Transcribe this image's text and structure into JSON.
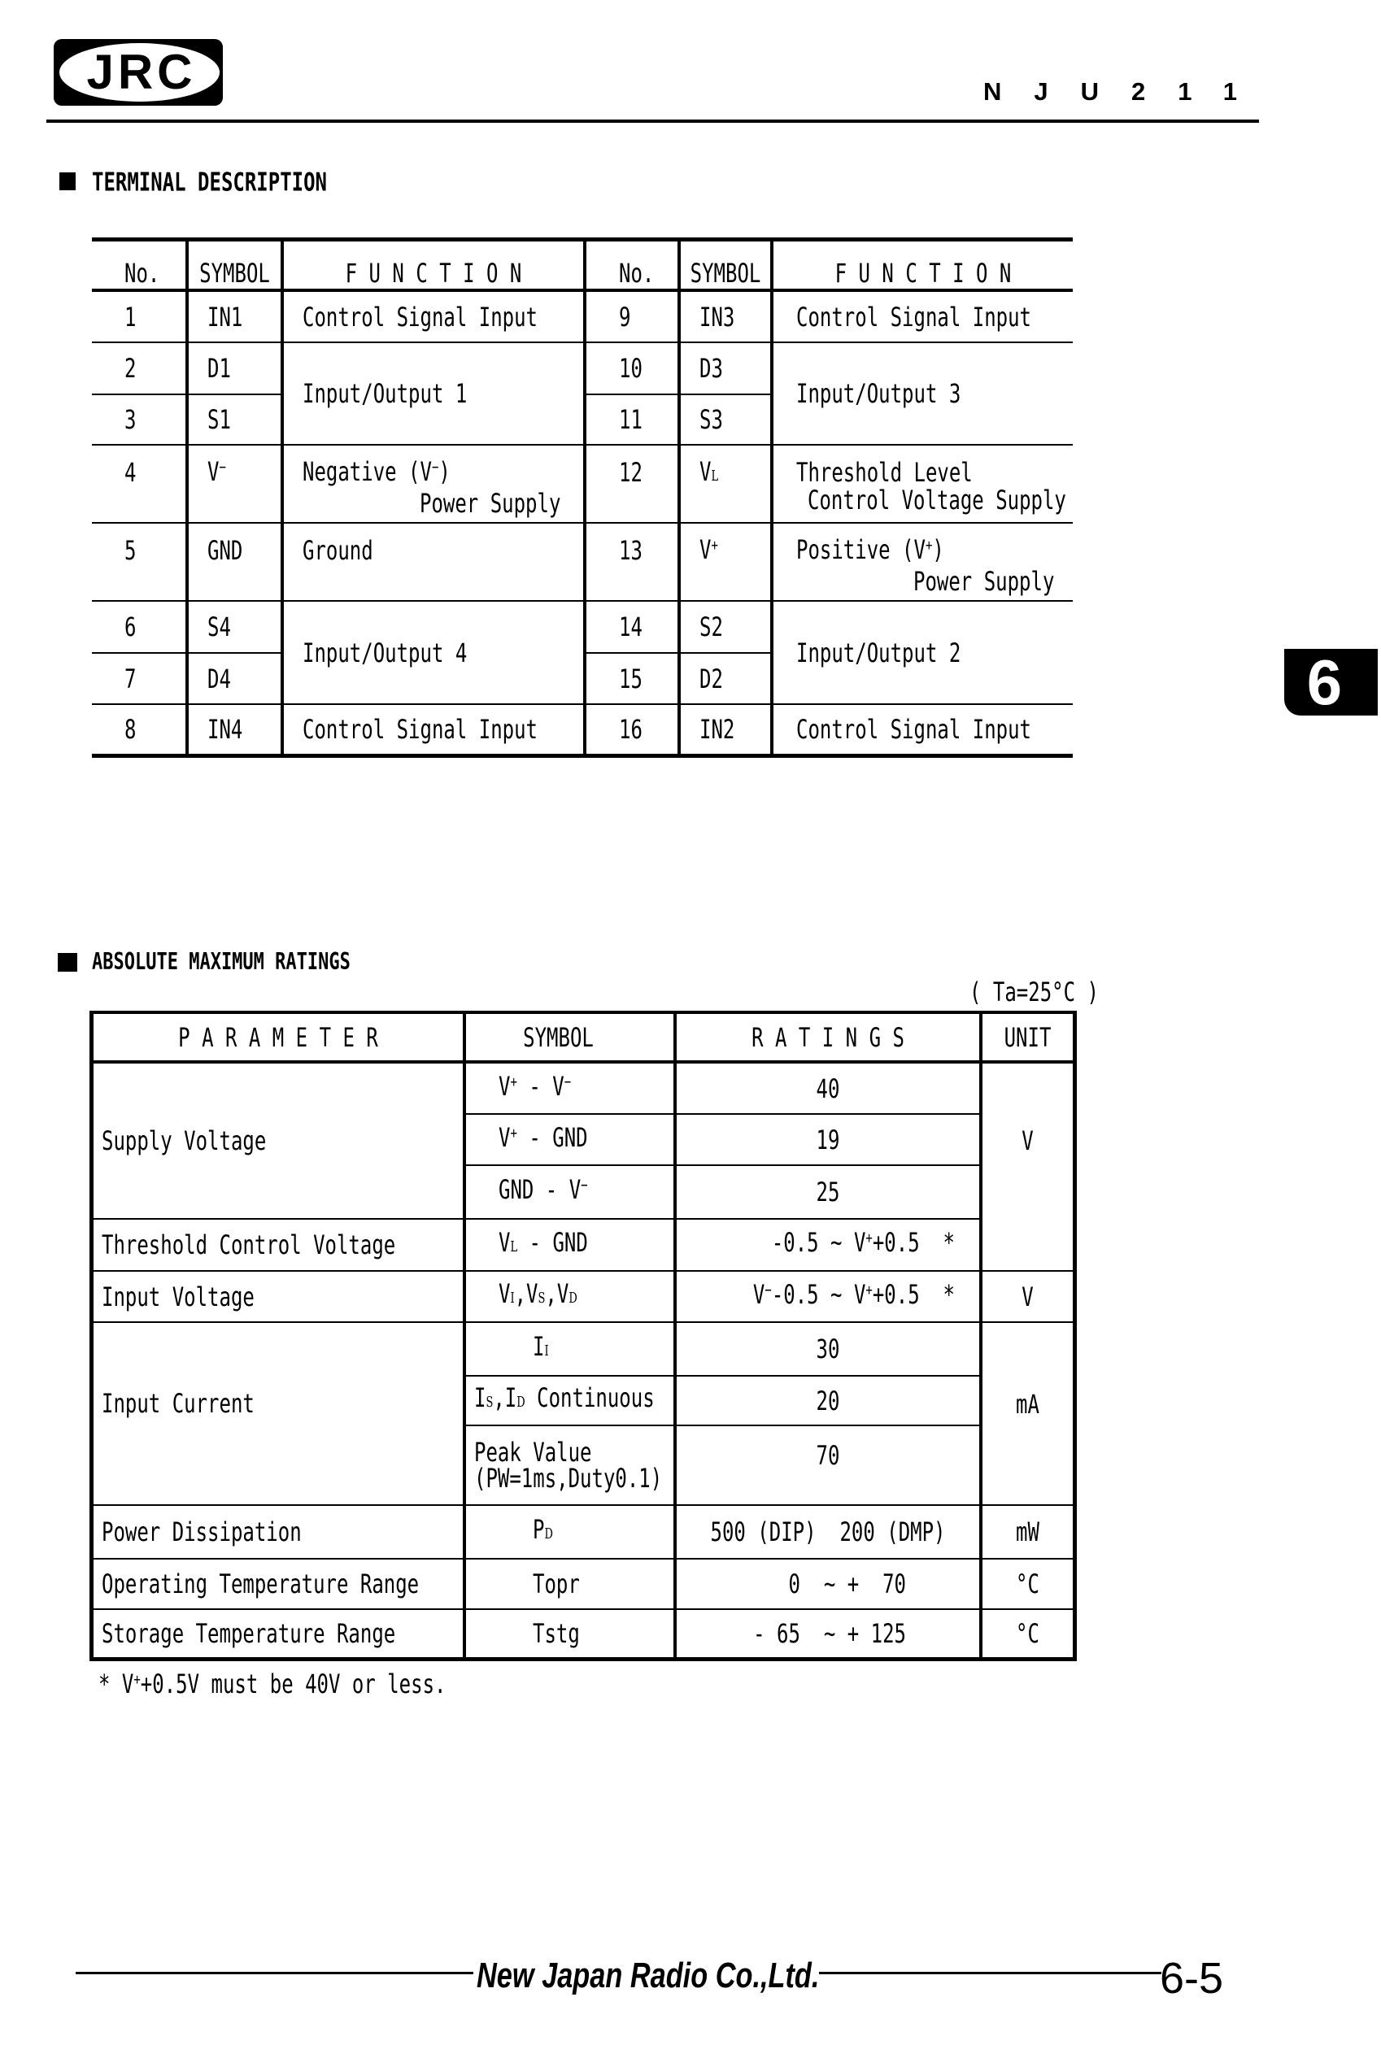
{
  "header": {
    "logo": "JRC",
    "part_number": "NJU211"
  },
  "side_tab": {
    "label": "6"
  },
  "terminal_description": {
    "title": "TERMINAL DESCRIPTION",
    "headers": {
      "no": "No.",
      "symbol": "SYMBOL",
      "function": "F U N C T I O N"
    },
    "pins": [
      {
        "no": "1",
        "symbol": "IN1"
      },
      {
        "no": "2",
        "symbol": "D1"
      },
      {
        "no": "3",
        "symbol": "S1"
      },
      {
        "no": "4",
        "symbol": [
          {
            "t": "V"
          },
          {
            "t": "−",
            "s": "sup"
          }
        ]
      },
      {
        "no": "5",
        "symbol": "GND"
      },
      {
        "no": "6",
        "symbol": "S4"
      },
      {
        "no": "7",
        "symbol": "D4"
      },
      {
        "no": "8",
        "symbol": "IN4"
      },
      {
        "no": "9",
        "symbol": "IN3"
      },
      {
        "no": "10",
        "symbol": "D3"
      },
      {
        "no": "11",
        "symbol": "S3"
      },
      {
        "no": "12",
        "symbol": [
          {
            "t": "V"
          },
          {
            "t": "L",
            "s": "sub"
          }
        ]
      },
      {
        "no": "13",
        "symbol": [
          {
            "t": "V"
          },
          {
            "t": "+",
            "s": "sup"
          }
        ]
      },
      {
        "no": "14",
        "symbol": "S2"
      },
      {
        "no": "15",
        "symbol": "D2"
      },
      {
        "no": "16",
        "symbol": "IN2"
      }
    ],
    "functions": [
      {
        "lines": [
          "Control Signal Input"
        ]
      },
      {
        "lines": [
          "Input/Output 1"
        ]
      },
      {
        "lines": [
          [
            {
              "t": "Negative (V"
            },
            {
              "t": "−",
              "s": "sup"
            },
            {
              "t": ")"
            }
          ],
          "Power Supply"
        ]
      },
      {
        "lines": [
          "Ground"
        ]
      },
      {
        "lines": [
          "Input/Output 4"
        ]
      },
      {
        "lines": [
          "Control Signal Input"
        ]
      },
      {
        "lines": [
          "Control Signal Input"
        ]
      },
      {
        "lines": [
          "Input/Output 3"
        ]
      },
      {
        "lines": [
          "Threshold Level",
          "Control Voltage Supply"
        ]
      },
      {
        "lines": [
          [
            {
              "t": "Positive (V"
            },
            {
              "t": "+",
              "s": "sup"
            },
            {
              "t": ")"
            }
          ],
          "Power Supply"
        ]
      },
      {
        "lines": [
          "Input/Output 2"
        ]
      },
      {
        "lines": [
          "Control Signal Input"
        ]
      }
    ]
  },
  "absolute_maximum_ratings": {
    "title": "ABSOLUTE MAXIMUM RATINGS",
    "condition": "( Ta=25°C )",
    "headers": {
      "parameter": "P A R A M E T E R",
      "symbol": "SYMBOL",
      "ratings": "R A T I N G S",
      "unit": "UNIT"
    },
    "parameters": [
      "Supply Voltage",
      "Threshold Control Voltage",
      "Input Voltage",
      "Input Current",
      "Power Dissipation",
      "Operating Temperature Range",
      "Storage Temperature Range"
    ],
    "rows": [
      {
        "symbol": [
          {
            "t": "V"
          },
          {
            "t": "+",
            "s": "sup"
          },
          {
            "t": " - V"
          },
          {
            "t": "−",
            "s": "sup"
          }
        ],
        "rating": "40"
      },
      {
        "symbol": [
          {
            "t": "V"
          },
          {
            "t": "+",
            "s": "sup"
          },
          {
            "t": " - GND"
          }
        ],
        "rating": "19"
      },
      {
        "symbol": [
          {
            "t": "GND - V"
          },
          {
            "t": "−",
            "s": "sup"
          }
        ],
        "rating": "25"
      },
      {
        "symbol": [
          {
            "t": "V"
          },
          {
            "t": "L",
            "s": "sub"
          },
          {
            "t": " - GND"
          }
        ],
        "rating": [
          {
            "t": "-0.5 ∼ V"
          },
          {
            "t": "+",
            "s": "sup"
          },
          {
            "t": "+0.5  *"
          }
        ]
      },
      {
        "symbol": [
          {
            "t": "V"
          },
          {
            "t": "I",
            "s": "sub"
          },
          {
            "t": ",V"
          },
          {
            "t": "S",
            "s": "sub"
          },
          {
            "t": ",V"
          },
          {
            "t": "D",
            "s": "sub"
          }
        ],
        "rating": [
          {
            "t": "V"
          },
          {
            "t": "−",
            "s": "sup"
          },
          {
            "t": "-0.5 ∼ V"
          },
          {
            "t": "+",
            "s": "sup"
          },
          {
            "t": "+0.5  *"
          }
        ]
      },
      {
        "symbol": [
          {
            "t": "I"
          },
          {
            "t": "I",
            "s": "sub"
          }
        ],
        "rating": "30"
      },
      {
        "symbol": [
          {
            "t": "I"
          },
          {
            "t": "S",
            "s": "sub"
          },
          {
            "t": ",I"
          },
          {
            "t": "D",
            "s": "sub"
          },
          {
            "t": " Continuous"
          }
        ],
        "rating": "20"
      },
      {
        "symbol": "Peak Value",
        "symbol_note": "(PW=1ms,Duty0.1)",
        "rating": "70"
      },
      {
        "symbol": [
          {
            "t": "P"
          },
          {
            "t": "D",
            "s": "sub"
          }
        ],
        "rating": "500 (DIP)  200 (DMP)"
      },
      {
        "symbol": "Topr",
        "rating": "0  ∼ +  70"
      },
      {
        "symbol": "Tstg",
        "rating": "- 65  ∼ + 125"
      }
    ],
    "units": [
      "V",
      "V",
      "mA",
      "mW",
      "°C",
      "°C"
    ],
    "footnote": [
      {
        "t": "* V"
      },
      {
        "t": "+",
        "s": "sup"
      },
      {
        "t": "+0.5V must be 40V or less."
      }
    ]
  },
  "footer": {
    "company": "New Japan Radio Co.,Ltd.",
    "page": "6-5"
  }
}
